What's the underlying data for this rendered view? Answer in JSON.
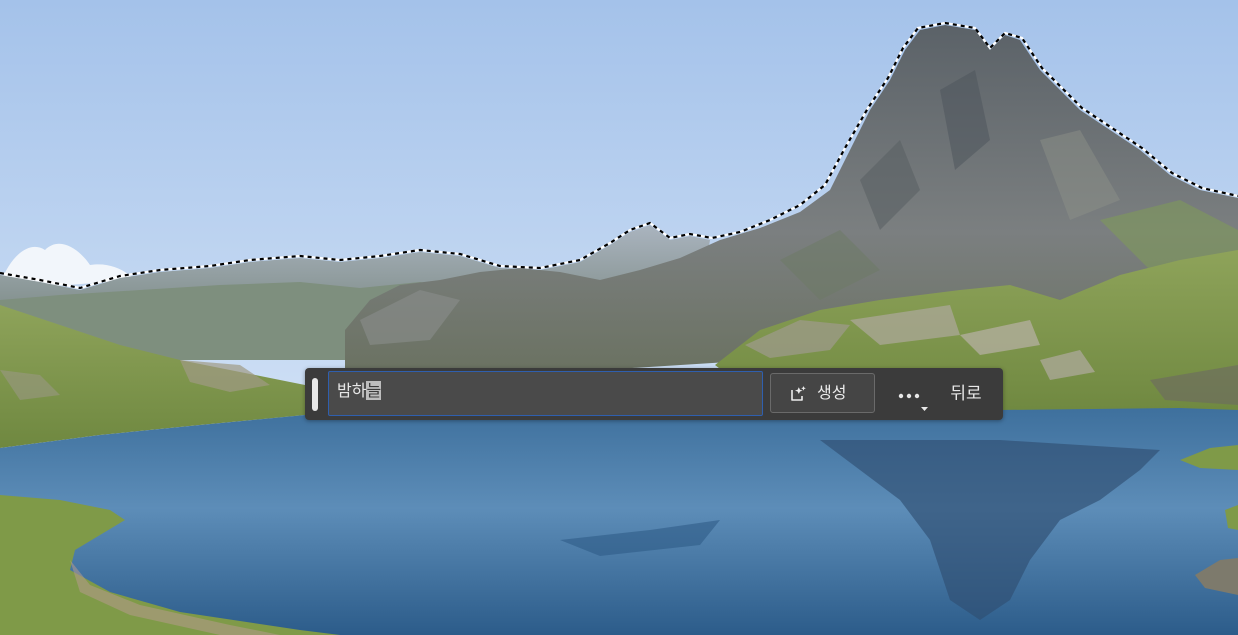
{
  "task_bar": {
    "prompt": {
      "committed_text": "밤하",
      "composing_text": "늘"
    },
    "generate_button": {
      "label": "생성",
      "icon": "generative-sparkle-icon"
    },
    "more_button": {
      "icon": "more-options-icon",
      "caret_icon": "chevron-down-icon"
    },
    "back_button": {
      "label": "뒤로"
    }
  },
  "colors": {
    "taskbar_bg": "#3b3b3b",
    "prompt_bg": "#4a4a4a",
    "prompt_border": "#2f5fae",
    "selection_outline": "#000000"
  }
}
